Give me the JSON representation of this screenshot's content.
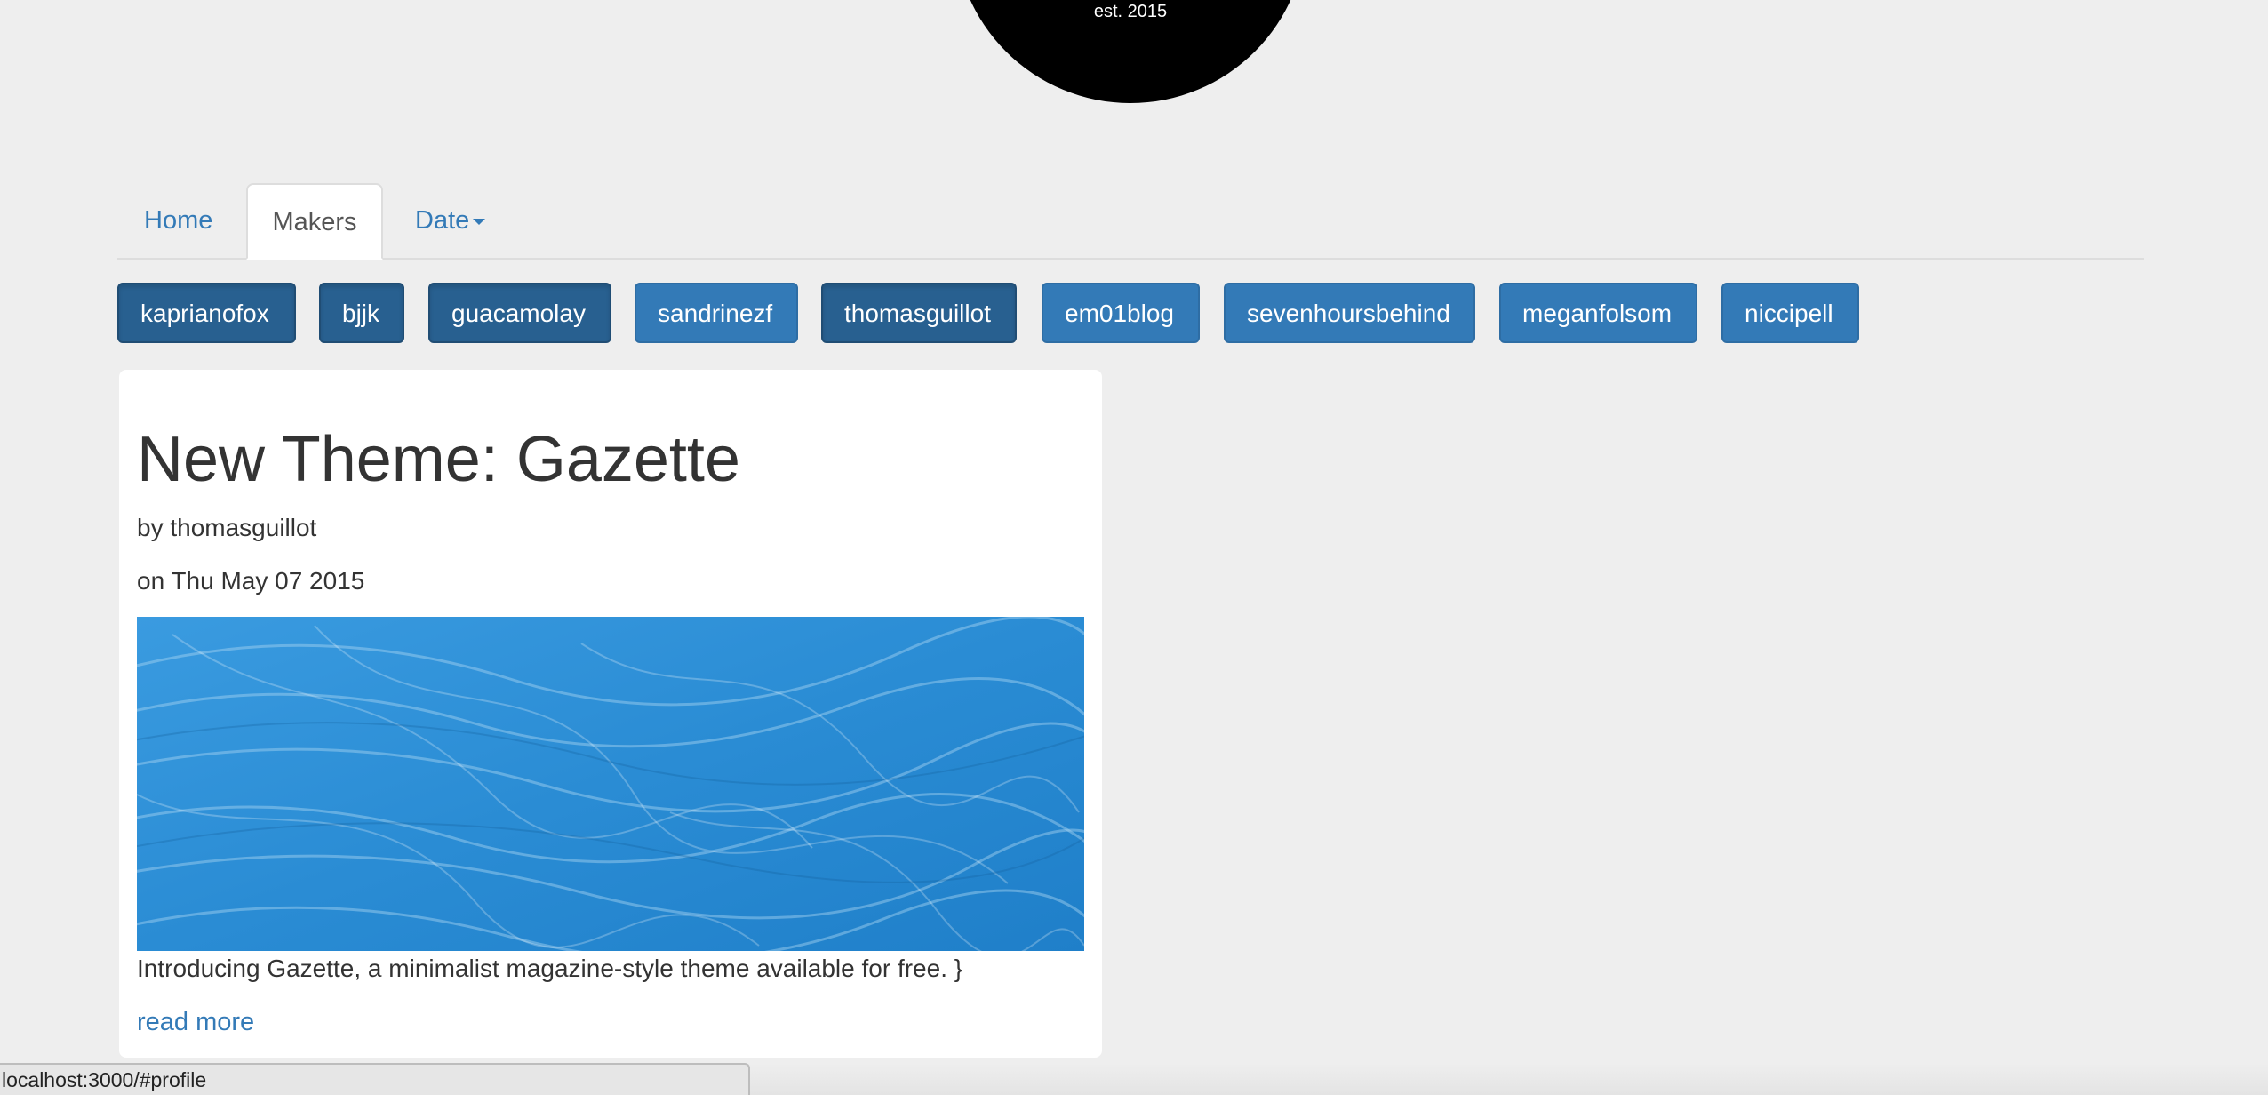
{
  "logo": {
    "est_text": "est. 2015",
    "color": "#000000"
  },
  "nav": {
    "tabs": [
      {
        "label": "Home",
        "active": false
      },
      {
        "label": "Makers",
        "active": true
      },
      {
        "label": "Date",
        "active": false,
        "dropdown": true
      }
    ]
  },
  "makers": [
    {
      "label": "kaprianofox",
      "active": true
    },
    {
      "label": "bjjk",
      "active": true
    },
    {
      "label": "guacamolay",
      "active": true
    },
    {
      "label": "sandrinezf",
      "active": false
    },
    {
      "label": "thomasguillot",
      "active": true
    },
    {
      "label": "em01blog",
      "active": false
    },
    {
      "label": "sevenhoursbehind",
      "active": false
    },
    {
      "label": "meganfolsom",
      "active": false
    },
    {
      "label": "niccipell",
      "active": false
    }
  ],
  "post": {
    "title": "New Theme: Gazette",
    "author": "by thomasguillot",
    "date": "on Thu May 07 2015",
    "excerpt": "Introducing Gazette, a minimalist magazine-style theme available for free. }",
    "read_more": "read more",
    "image_color": "#2b8fd6"
  },
  "status_bar": {
    "url": "localhost:3000/#profile"
  },
  "colors": {
    "primary": "#337ab7",
    "primary_active": "#286090",
    "background": "#eeeeee"
  }
}
